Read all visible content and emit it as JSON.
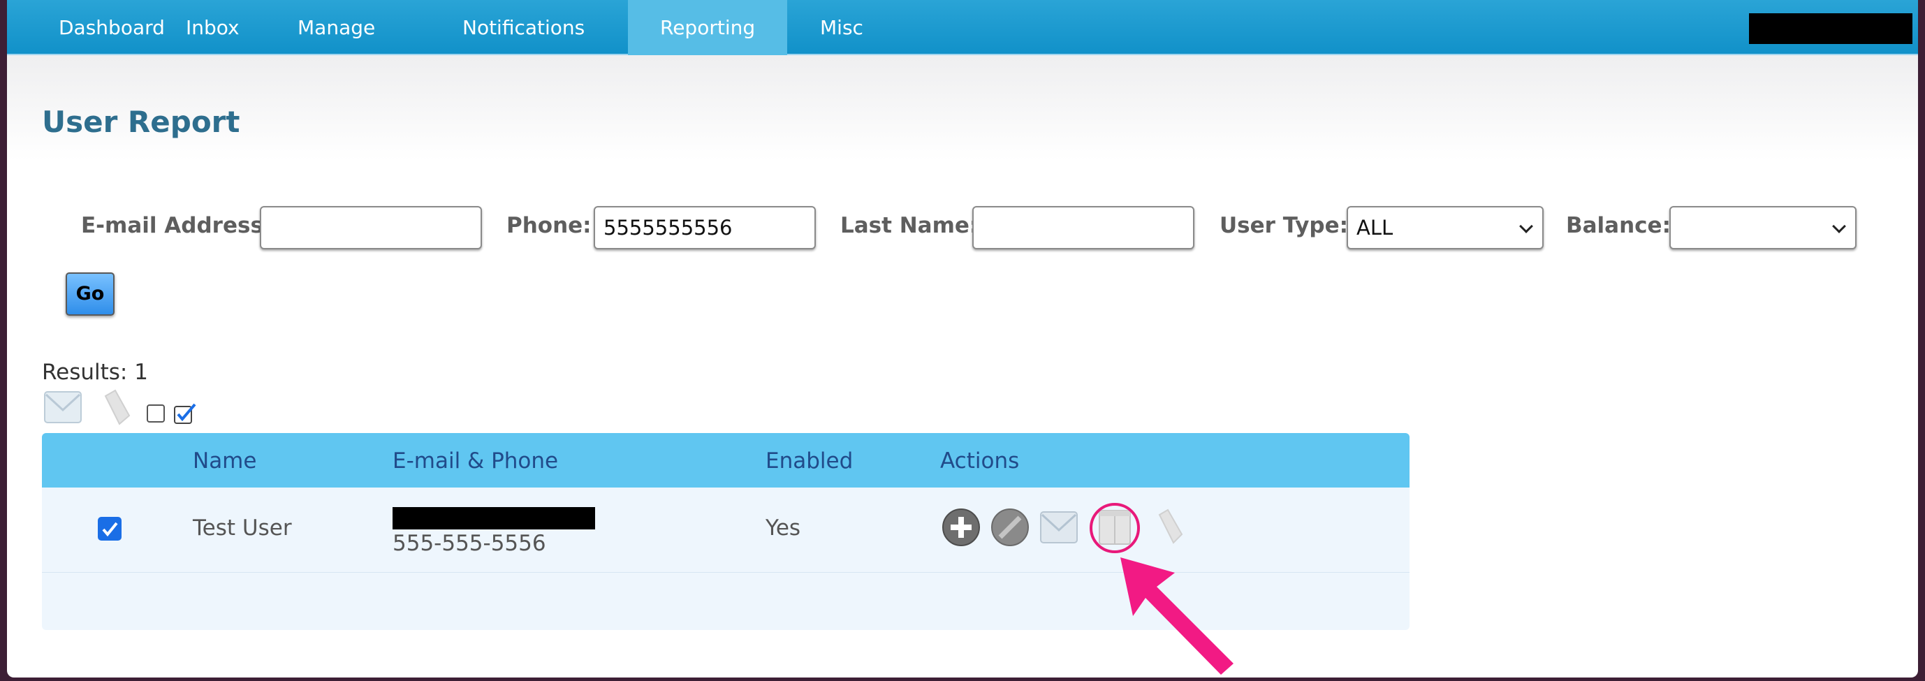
{
  "nav": {
    "items": [
      {
        "label": "Dashboard"
      },
      {
        "label": "Inbox"
      },
      {
        "label": "Manage"
      },
      {
        "label": "Notifications"
      },
      {
        "label": "Reporting",
        "active": true
      },
      {
        "label": "Misc"
      }
    ]
  },
  "page": {
    "title": "User Report"
  },
  "filters": {
    "email_label": "E-mail Address:",
    "email_value": "",
    "phone_label": "Phone:",
    "phone_value": "5555555556",
    "lastname_label": "Last Name:",
    "lastname_value": "",
    "usertype_label": "User Type:",
    "usertype_value": "ALL",
    "balance_label": "Balance:",
    "balance_value": "",
    "go_label": "Go"
  },
  "results": {
    "label": "Results: 1"
  },
  "table": {
    "headers": {
      "name": "Name",
      "contact": "E-mail & Phone",
      "enabled": "Enabled",
      "actions": "Actions"
    },
    "rows": [
      {
        "name": "Test User",
        "phone": "555-555-5556",
        "enabled": "Yes",
        "checked": true
      }
    ]
  },
  "icons": {
    "add": "plus-circle-icon",
    "disable": "no-entry-icon",
    "email": "envelope-icon",
    "report": "clipboard-icon",
    "tag": "tag-icon"
  },
  "colors": {
    "nav": "#1191c9",
    "nav_active": "#56bde6",
    "title": "#2e6e8e",
    "table_header": "#60c6f1",
    "highlight": "#e8197a"
  }
}
